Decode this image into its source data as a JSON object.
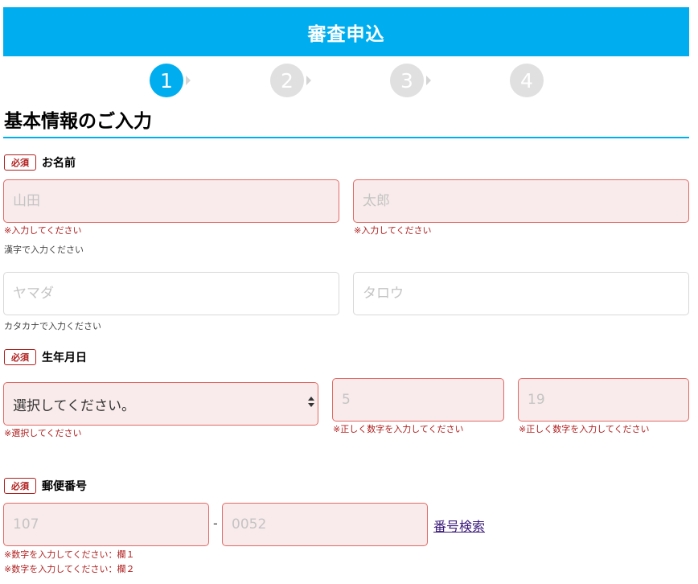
{
  "header": {
    "title": "審査申込"
  },
  "steps": [
    "1",
    "2",
    "3",
    "4"
  ],
  "section": {
    "title": "基本情報のご入力"
  },
  "required_badge": "必須",
  "name": {
    "label": "お名前",
    "last_kanji": {
      "placeholder": "山田",
      "error": "※入力してください"
    },
    "first_kanji": {
      "placeholder": "太郎",
      "error": "※入力してください"
    },
    "kanji_hint": "漢字で入力ください",
    "last_kana": {
      "placeholder": "ヤマダ"
    },
    "first_kana": {
      "placeholder": "タロウ"
    },
    "kana_hint": "カタカナで入力ください"
  },
  "birthdate": {
    "label": "生年月日",
    "year": {
      "value": "選択してください。",
      "error": "※選択してください"
    },
    "month": {
      "placeholder": "5",
      "error": "※正しく数字を入力してください"
    },
    "day": {
      "placeholder": "19",
      "error": "※正しく数字を入力してください"
    }
  },
  "postal": {
    "label": "郵便番号",
    "first": {
      "placeholder": "107"
    },
    "separator": "-",
    "second": {
      "placeholder": "0052"
    },
    "search_link": "番号検索",
    "error1": "※数字を入力してください：欄１",
    "error2": "※数字を入力してください：欄２"
  }
}
